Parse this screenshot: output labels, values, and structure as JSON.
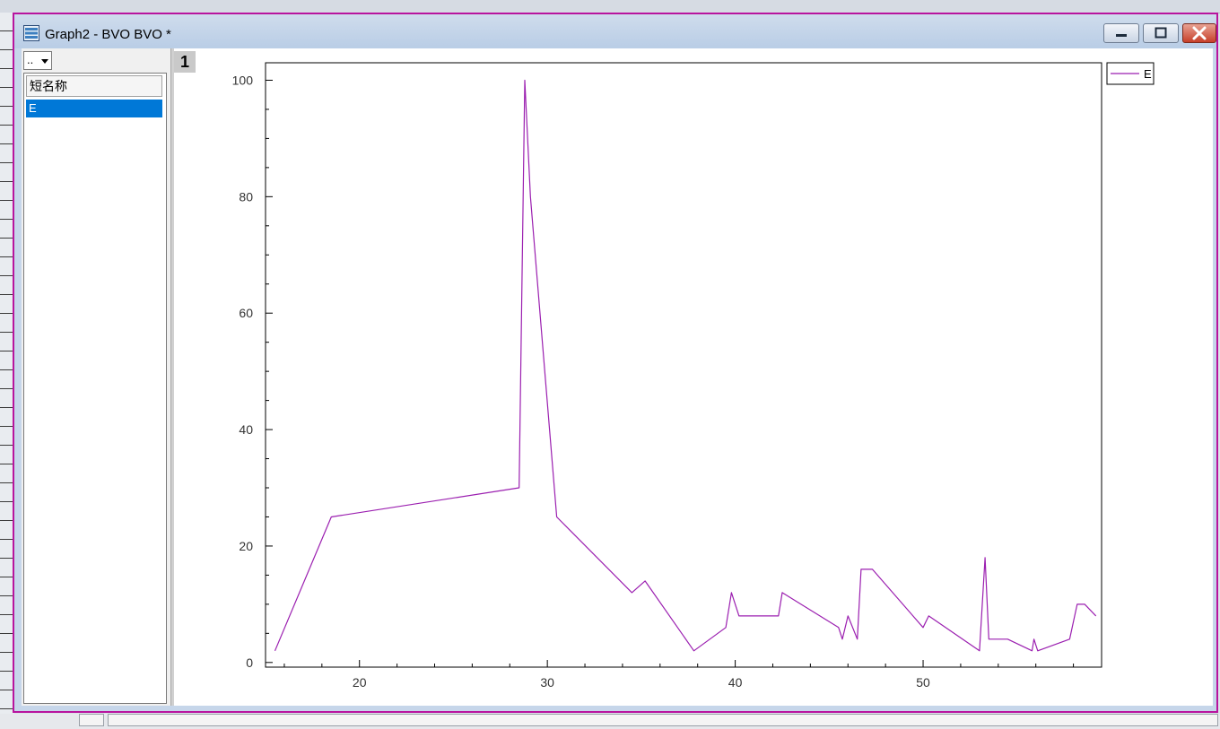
{
  "window": {
    "title": "Graph2 - BVO BVO *",
    "accent_border": "#b8149e"
  },
  "left_panel": {
    "dropdown_value": "..",
    "column_header": "短名称",
    "items": [
      "E"
    ]
  },
  "graph": {
    "layer_badge": "1"
  },
  "chart_data": {
    "type": "line",
    "title": "",
    "xlabel": "",
    "ylabel": "",
    "xlim": [
      15,
      59.5
    ],
    "ylim": [
      -0.8,
      103
    ],
    "x_ticks": [
      20,
      30,
      40,
      50
    ],
    "y_ticks": [
      0,
      20,
      40,
      60,
      80,
      100
    ],
    "grid": false,
    "legend": "top-right outside",
    "series": [
      {
        "name": "E",
        "color": "#9b1fb0",
        "points": [
          [
            15.5,
            2
          ],
          [
            18.5,
            25
          ],
          [
            28.5,
            30
          ],
          [
            28.8,
            100
          ],
          [
            29.1,
            80
          ],
          [
            30.5,
            25
          ],
          [
            34.5,
            12
          ],
          [
            35.2,
            14
          ],
          [
            37.8,
            2
          ],
          [
            39.5,
            6
          ],
          [
            39.8,
            12
          ],
          [
            40.2,
            8
          ],
          [
            42.3,
            8
          ],
          [
            42.5,
            12
          ],
          [
            45.5,
            6
          ],
          [
            45.7,
            4
          ],
          [
            46.0,
            8
          ],
          [
            46.5,
            4
          ],
          [
            46.7,
            16
          ],
          [
            47.3,
            16
          ],
          [
            50.0,
            6
          ],
          [
            50.3,
            8
          ],
          [
            53.0,
            2
          ],
          [
            53.3,
            18
          ],
          [
            53.5,
            4
          ],
          [
            54.5,
            4
          ],
          [
            55.8,
            2
          ],
          [
            55.9,
            4
          ],
          [
            56.1,
            2
          ],
          [
            57.8,
            4
          ],
          [
            58.2,
            10
          ],
          [
            58.6,
            10
          ],
          [
            59.2,
            8
          ]
        ]
      }
    ]
  }
}
